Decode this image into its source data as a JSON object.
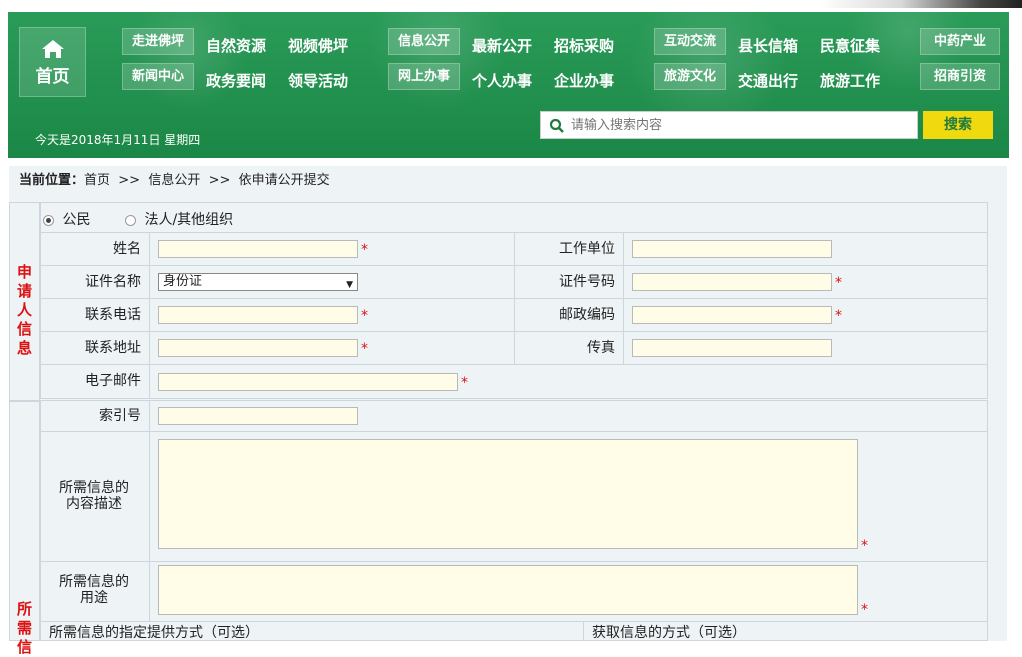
{
  "header": {
    "home_label": "首页",
    "date_text": "今天是2018年1月11日  星期四",
    "search_placeholder": "请输入搜索内容",
    "search_button": "搜索",
    "nav": [
      {
        "tag": "走进佛坪",
        "links": [
          "自然资源",
          "视频佛坪"
        ]
      },
      {
        "tag": "新闻中心",
        "links": [
          "政务要闻",
          "领导活动"
        ]
      },
      {
        "tag": "信息公开",
        "links": [
          "最新公开",
          "招标采购"
        ]
      },
      {
        "tag": "网上办事",
        "links": [
          "个人办事",
          "企业办事"
        ]
      },
      {
        "tag": "互动交流",
        "links": [
          "县长信箱",
          "民意征集"
        ]
      },
      {
        "tag": "旅游文化",
        "links": [
          "交通出行",
          "旅游工作"
        ]
      },
      {
        "tag": "中药产业",
        "links": []
      },
      {
        "tag": "招商引资",
        "links": []
      }
    ]
  },
  "breadcrumb": {
    "prefix": "当前位置：",
    "path": "首页  >>  信息公开  >>  依申请公开提交"
  },
  "form": {
    "section_applicant": [
      "申",
      "请",
      "人",
      "信",
      "息"
    ],
    "section_needed": [
      "所",
      "需",
      "信"
    ],
    "type_options": {
      "citizen": "公民",
      "legal": "法人/其他组织"
    },
    "labels": {
      "name": "姓名",
      "work_unit": "工作单位",
      "id_type": "证件名称",
      "id_number": "证件号码",
      "phone": "联系电话",
      "postcode": "邮政编码",
      "address": "联系地址",
      "fax": "传真",
      "email": "电子邮件",
      "index_no": "索引号",
      "content_desc": "所需信息的\n内容描述",
      "purpose": "所需信息的\n用途",
      "provide_method": "所需信息的指定提供方式（可选）",
      "obtain_method": "获取信息的方式（可选）"
    },
    "id_type_value": "身份证",
    "required_mark": "*"
  }
}
